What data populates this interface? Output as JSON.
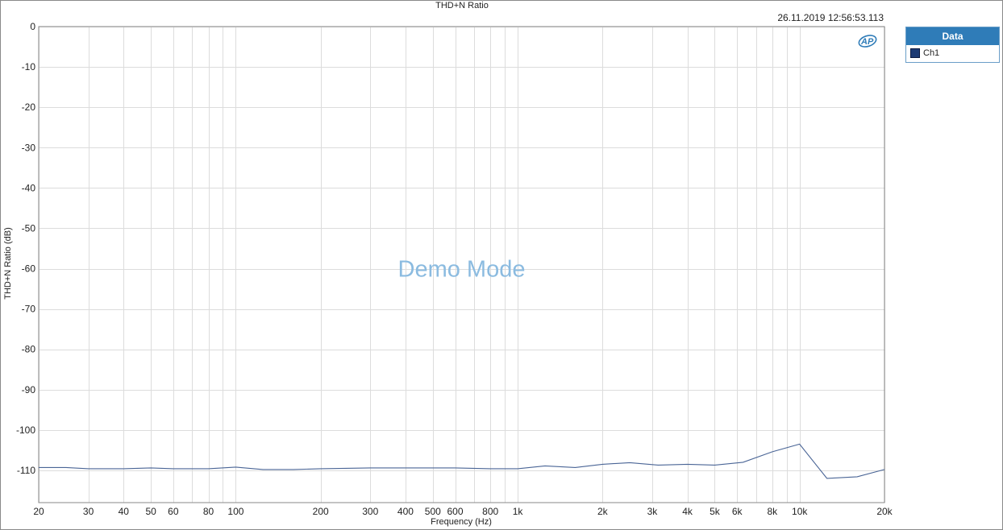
{
  "chart_data": {
    "type": "line",
    "title": "THD+N Ratio",
    "timestamp": "26.11.2019 12:56:53.113",
    "watermark": "Demo Mode",
    "xlabel": "Frequency (Hz)",
    "ylabel": "THD+N Ratio (dB)",
    "xscale": "log",
    "xlim": [
      20,
      20000
    ],
    "ylim": [
      -118,
      0
    ],
    "grid": true,
    "legend_position": "right",
    "legend_title": "Data",
    "x_ticks": [
      {
        "v": 20,
        "label": "20"
      },
      {
        "v": 30,
        "label": "30"
      },
      {
        "v": 40,
        "label": "40"
      },
      {
        "v": 50,
        "label": "50"
      },
      {
        "v": 60,
        "label": "60"
      },
      {
        "v": 80,
        "label": "80"
      },
      {
        "v": 100,
        "label": "100"
      },
      {
        "v": 200,
        "label": "200"
      },
      {
        "v": 300,
        "label": "300"
      },
      {
        "v": 400,
        "label": "400"
      },
      {
        "v": 500,
        "label": "500"
      },
      {
        "v": 600,
        "label": "600"
      },
      {
        "v": 800,
        "label": "800"
      },
      {
        "v": 1000,
        "label": "1k"
      },
      {
        "v": 2000,
        "label": "2k"
      },
      {
        "v": 3000,
        "label": "3k"
      },
      {
        "v": 4000,
        "label": "4k"
      },
      {
        "v": 5000,
        "label": "5k"
      },
      {
        "v": 6000,
        "label": "6k"
      },
      {
        "v": 8000,
        "label": "8k"
      },
      {
        "v": 10000,
        "label": "10k"
      },
      {
        "v": 20000,
        "label": "20k"
      }
    ],
    "x_minor_grid": [
      70,
      90,
      700,
      900,
      7000,
      9000
    ],
    "y_ticks": [
      {
        "v": 0,
        "label": "0"
      },
      {
        "v": -10,
        "label": "-10"
      },
      {
        "v": -20,
        "label": "-20"
      },
      {
        "v": -30,
        "label": "-30"
      },
      {
        "v": -40,
        "label": "-40"
      },
      {
        "v": -50,
        "label": "-50"
      },
      {
        "v": -60,
        "label": "-60"
      },
      {
        "v": -70,
        "label": "-70"
      },
      {
        "v": -80,
        "label": "-80"
      },
      {
        "v": -90,
        "label": "-90"
      },
      {
        "v": -100,
        "label": "-100"
      },
      {
        "v": -110,
        "label": "-110"
      }
    ],
    "series": [
      {
        "name": "Ch1",
        "color": "#4a6596",
        "x": [
          20,
          25,
          30,
          40,
          50,
          60,
          80,
          100,
          125,
          160,
          200,
          300,
          400,
          500,
          600,
          800,
          1000,
          1250,
          1600,
          2000,
          2500,
          3150,
          4000,
          5000,
          6300,
          8000,
          10000,
          12500,
          16000,
          20000
        ],
        "y": [
          -109.3,
          -109.3,
          -109.6,
          -109.6,
          -109.4,
          -109.6,
          -109.6,
          -109.2,
          -109.8,
          -109.8,
          -109.6,
          -109.4,
          -109.4,
          -109.4,
          -109.4,
          -109.6,
          -109.6,
          -108.9,
          -109.3,
          -108.5,
          -108.1,
          -108.7,
          -108.5,
          -108.7,
          -108,
          -105.4,
          -103.5,
          -112,
          -111.6,
          -109.8
        ]
      }
    ]
  },
  "legend": {
    "header": "Data",
    "items": [
      {
        "label": "Ch1",
        "color": "#1c3a73"
      }
    ]
  },
  "logo": {
    "text": "AP",
    "icon": "ap-logo-icon",
    "color": "#2f7cb8"
  }
}
